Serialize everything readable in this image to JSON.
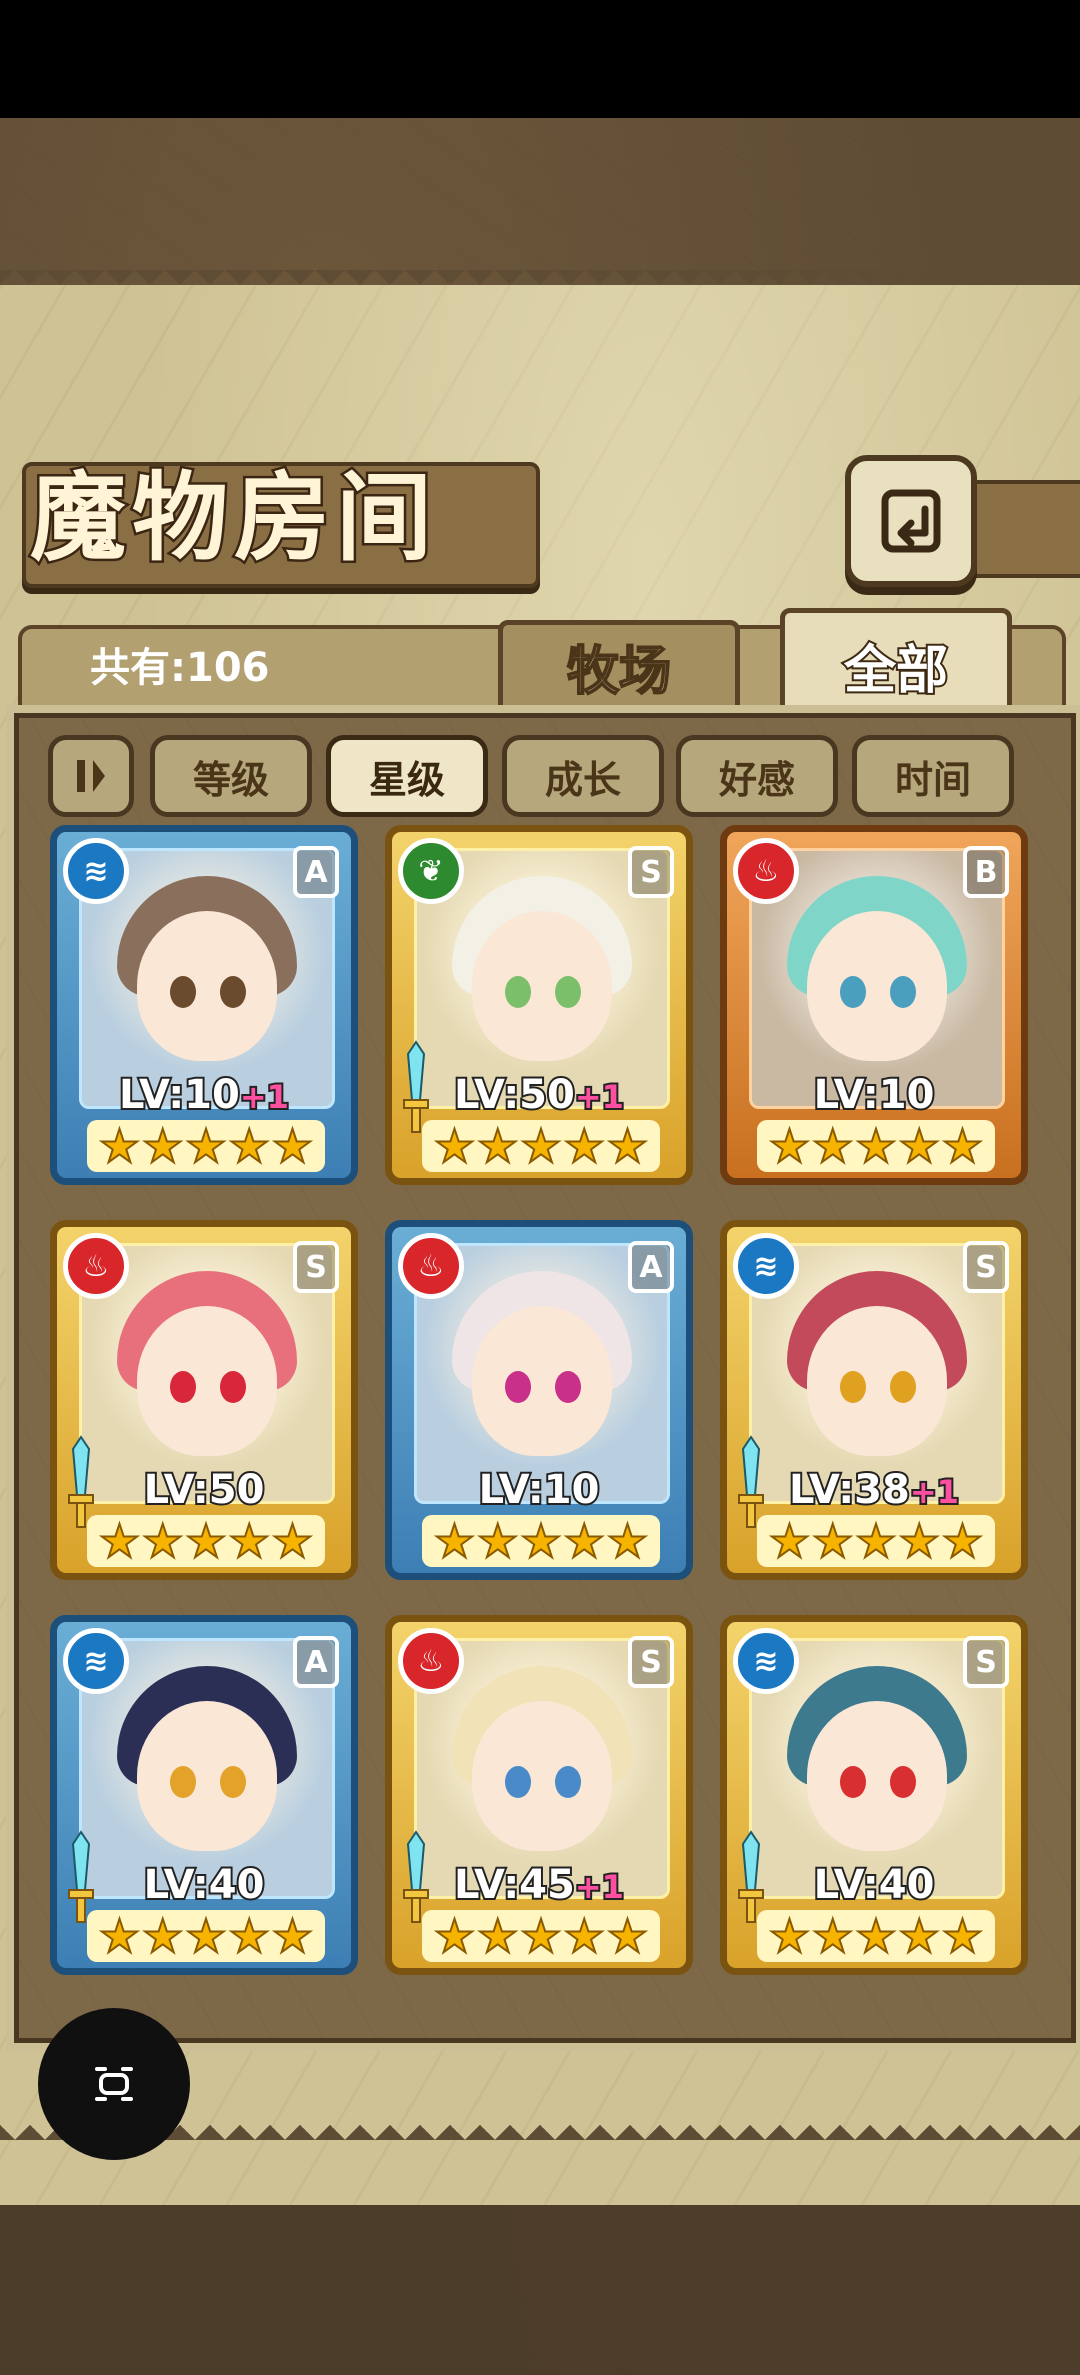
{
  "title": "魔物房间",
  "total_label": "共有:106",
  "tabs": [
    {
      "label": "牧场",
      "active": false
    },
    {
      "label": "全部",
      "active": true
    }
  ],
  "sort_buttons": [
    {
      "label": "等级",
      "active": false
    },
    {
      "label": "星级",
      "active": true
    },
    {
      "label": "成长",
      "active": false
    },
    {
      "label": "好感",
      "active": false
    },
    {
      "label": "时间",
      "active": false
    }
  ],
  "monsters": [
    {
      "level": "LV:10",
      "plus": "+1",
      "rank": "A",
      "element": "water",
      "stars": 5,
      "frame": "blue",
      "weapon": false,
      "hair": "#8a6f5c",
      "eyes": "#6b4b2d"
    },
    {
      "level": "LV:50",
      "plus": "+1",
      "rank": "S",
      "element": "nature",
      "stars": 5,
      "frame": "gold",
      "weapon": true,
      "hair": "#f3f0e6",
      "eyes": "#7bbf6a"
    },
    {
      "level": "LV:10",
      "plus": "",
      "rank": "B",
      "element": "fire",
      "stars": 5,
      "frame": "orange",
      "weapon": false,
      "hair": "#7fd6c8",
      "eyes": "#4a9fbf"
    },
    {
      "level": "LV:50",
      "plus": "",
      "rank": "S",
      "element": "fire",
      "stars": 5,
      "frame": "gold",
      "weapon": true,
      "hair": "#e8707c",
      "eyes": "#d8263a"
    },
    {
      "level": "LV:10",
      "plus": "",
      "rank": "A",
      "element": "fire",
      "stars": 5,
      "frame": "blue",
      "weapon": false,
      "hair": "#efe4e6",
      "eyes": "#c8308a"
    },
    {
      "level": "LV:38",
      "plus": "+1",
      "rank": "S",
      "element": "water",
      "stars": 5,
      "frame": "gold",
      "weapon": true,
      "hair": "#c24a5a",
      "eyes": "#e0a020"
    },
    {
      "level": "LV:40",
      "plus": "",
      "rank": "A",
      "element": "water",
      "stars": 5,
      "frame": "blue",
      "weapon": true,
      "hair": "#2c2f55",
      "eyes": "#e3a32a"
    },
    {
      "level": "LV:45",
      "plus": "+1",
      "rank": "S",
      "element": "fire",
      "stars": 5,
      "frame": "gold",
      "weapon": true,
      "hair": "#f1e2b8",
      "eyes": "#4a8ac8"
    },
    {
      "level": "LV:40",
      "plus": "",
      "rank": "S",
      "element": "water",
      "stars": 5,
      "frame": "gold",
      "weapon": true,
      "hair": "#3e7a8e",
      "eyes": "#d83030"
    }
  ]
}
